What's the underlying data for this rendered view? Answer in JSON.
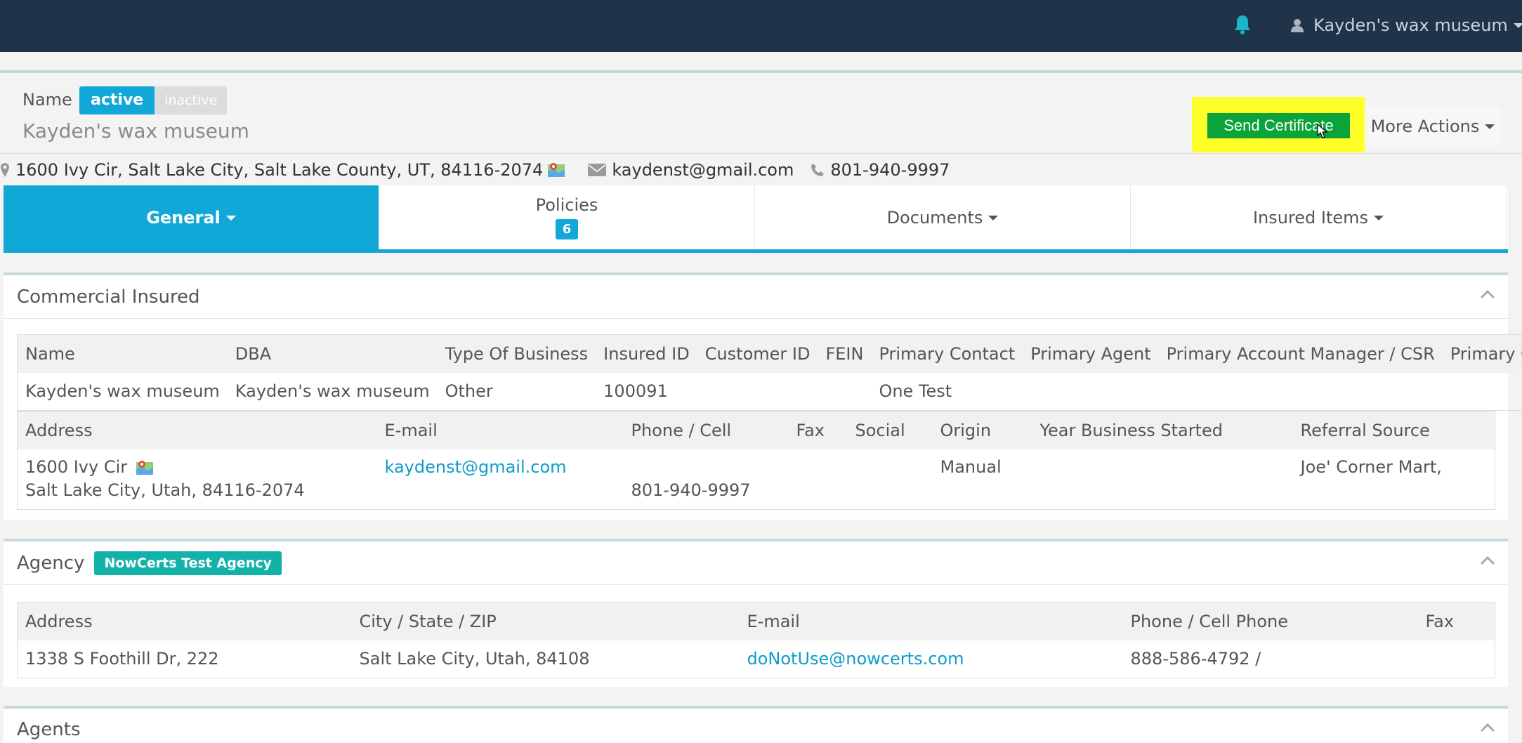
{
  "topbar": {
    "user_name": "Kayden's wax museum",
    "bell_icon": "bell-icon",
    "user_icon": "user-icon"
  },
  "header": {
    "name_label": "Name",
    "status_active": "active",
    "status_inactive": "inactive",
    "insured_name": "Kayden's wax museum",
    "send_certificate": "Send Certificate",
    "more_actions": "More Actions"
  },
  "contact": {
    "address": "1600 Ivy Cir, Salt Lake City, Salt Lake County, UT, 84116-2074",
    "email": "kaydenst@gmail.com",
    "phone": "801-940-9997"
  },
  "tabs": [
    {
      "label": "General",
      "badge": ""
    },
    {
      "label": "Policies",
      "badge": "6"
    },
    {
      "label": "Documents",
      "badge": ""
    },
    {
      "label": "Insured Items",
      "badge": ""
    }
  ],
  "commercial": {
    "title": "Commercial Insured",
    "headers1": [
      "Name",
      "DBA",
      "Type Of Business",
      "Insured ID",
      "Customer ID",
      "FEIN",
      "Primary Contact",
      "Primary Agent",
      "Primary Account Manager / CSR",
      "Primary Office"
    ],
    "row1": [
      "Kayden's wax museum",
      "Kayden's wax museum",
      "Other",
      "100091",
      "",
      "",
      "One Test",
      "",
      "",
      ""
    ],
    "headers2": [
      "Address",
      "E-mail",
      "Phone / Cell",
      "Fax",
      "Social",
      "Origin",
      "Year Business Started",
      "Referral Source"
    ],
    "address_line1": "1600 Ivy Cir",
    "address_line2": "Salt Lake City, Utah, 84116-2074",
    "email": "kaydenst@gmail.com",
    "phone_line1": "",
    "phone_line2": "801-940-9997",
    "fax": "",
    "social": "",
    "origin": "Manual",
    "year_started": "",
    "referral": "Joe' Corner Mart,"
  },
  "agency": {
    "title": "Agency",
    "badge": "NowCerts Test Agency",
    "headers": [
      "Address",
      "City / State / ZIP",
      "E-mail",
      "Phone / Cell Phone",
      "Fax"
    ],
    "address": "1338 S Foothill Dr, 222",
    "city_state_zip": "Salt Lake City, Utah, 84108",
    "email": "doNotUse@nowcerts.com",
    "phone": "888-586-4792 /",
    "fax": ""
  },
  "agents": {
    "title": "Agents"
  },
  "colors": {
    "topbar": "#1f3349",
    "accent": "#11a7d7",
    "send_button": "#0aa43b",
    "highlight": "#ffff29",
    "agency_badge": "#12b2a9"
  }
}
